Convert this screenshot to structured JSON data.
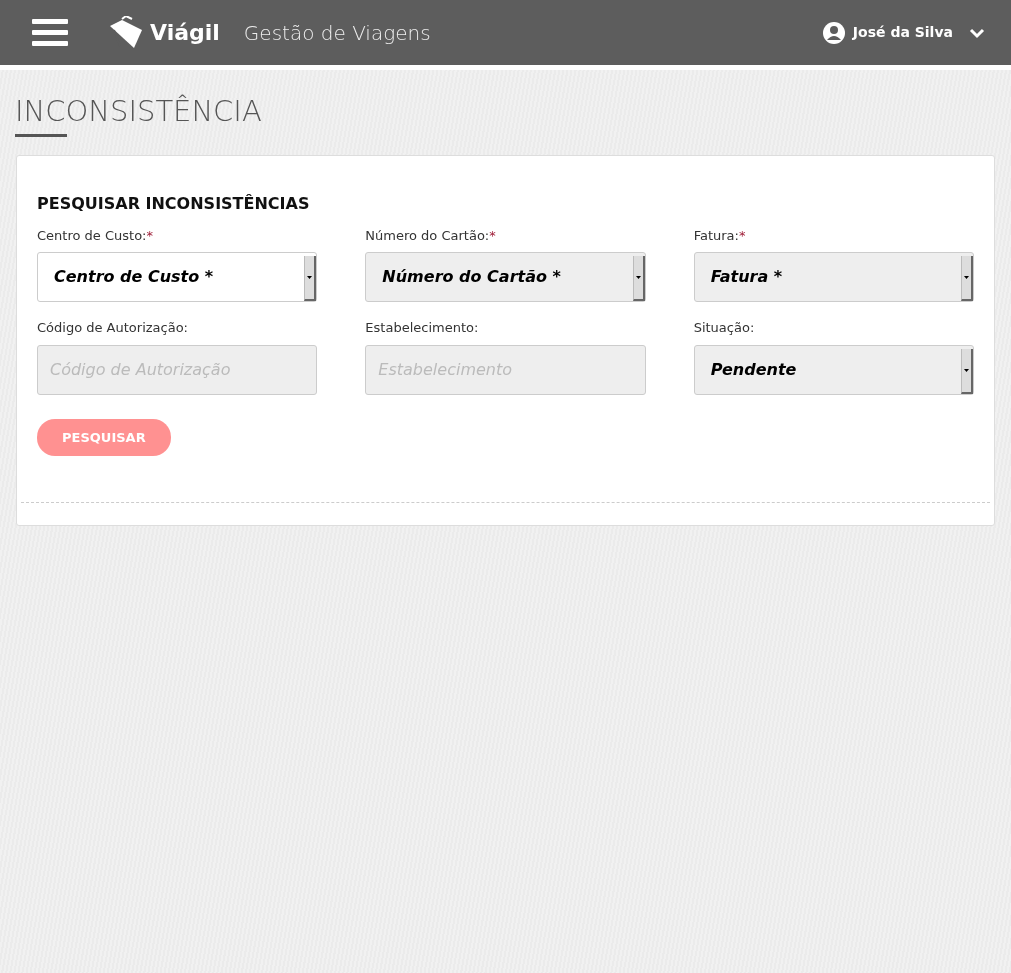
{
  "header": {
    "brand": "Viágil",
    "subtitle": "Gestão de Viagens",
    "user": "José da Silva"
  },
  "page_title": "INCONSISTÊNCIA",
  "panel": {
    "title": "PESQUISAR INCONSISTÊNCIAS",
    "fields": [
      {
        "kind": "select",
        "label": "Centro de Custo:",
        "required_mark": "*",
        "value": "Centro de Custo *",
        "disabled": false
      },
      {
        "kind": "select",
        "label": "Número do Cartão:",
        "required_mark": "*",
        "value": "Número do Cartão *",
        "disabled": true
      },
      {
        "kind": "select",
        "label": "Fatura:",
        "required_mark": "*",
        "value": "Fatura *",
        "disabled": true
      },
      {
        "kind": "text",
        "label": "Código de Autorização:",
        "placeholder": "Código de Autorização",
        "disabled": true
      },
      {
        "kind": "text",
        "label": "Estabelecimento:",
        "placeholder": "Estabelecimento",
        "disabled": true
      },
      {
        "kind": "select",
        "label": "Situação:",
        "value": "Pendente",
        "disabled": true
      }
    ],
    "button": {
      "label": "PESQUISAR",
      "disabled": true
    }
  }
}
